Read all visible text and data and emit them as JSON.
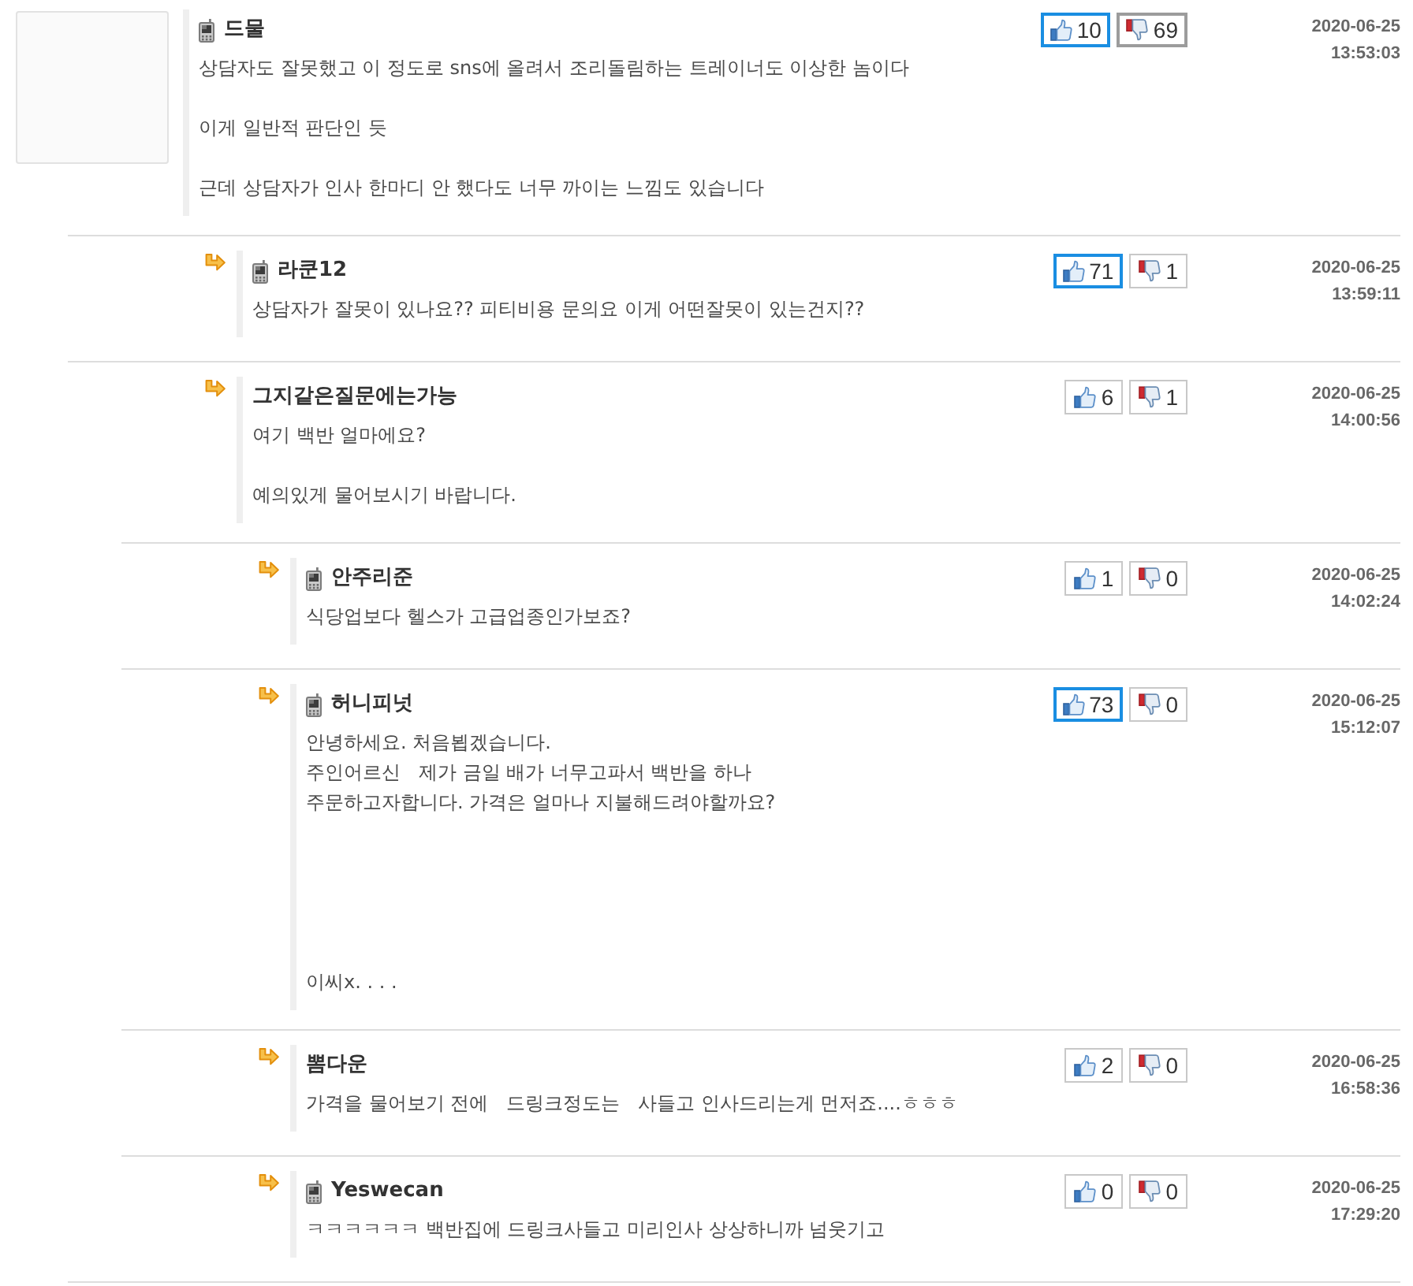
{
  "comments": [
    {
      "author": "드물",
      "mobile": true,
      "body": "상담자도 잘못했고 이 정도로 sns에 올려서 조리돌림하는 트레이너도 이상한 놈이다\n\n이게 일반적 판단인 듯\n\n근데 상담자가 인사 한마디 안 했다도 너무 까이는 느낌도 있습니다",
      "likes": {
        "count": "10",
        "emphasized": true
      },
      "dislikes": {
        "count": "69",
        "emphasized": true
      },
      "date": "2020-06-25",
      "time": "13:53:03",
      "children": [
        {
          "author": "라쿤12",
          "mobile": true,
          "body": "상담자가 잘못이 있나요?? 피티비용 문의요 이게 어떤잘못이 있는건지??",
          "likes": {
            "count": "71",
            "emphasized": true
          },
          "dislikes": {
            "count": "1",
            "emphasized": false
          },
          "date": "2020-06-25",
          "time": "13:59:11"
        },
        {
          "author": "그지같은질문에는가능",
          "mobile": false,
          "body": "여기 백반 얼마에요?\n\n예의있게 물어보시기 바랍니다.",
          "likes": {
            "count": "6",
            "emphasized": false
          },
          "dislikes": {
            "count": "1",
            "emphasized": false
          },
          "date": "2020-06-25",
          "time": "14:00:56",
          "children": [
            {
              "author": "안주리준",
              "mobile": true,
              "body": "식당업보다 헬스가 고급업종인가보죠?",
              "likes": {
                "count": "1",
                "emphasized": false
              },
              "dislikes": {
                "count": "0",
                "emphasized": false
              },
              "date": "2020-06-25",
              "time": "14:02:24"
            },
            {
              "author": "허니피넛",
              "mobile": true,
              "body": "안녕하세요. 처음뵙겠습니다.\n주인어르신   제가 금일 배가 너무고파서 백반을 하나\n주문하고자합니다. 가격은 얼마나 지불해드려야할까요?\n\n\n\n\n\n이씨x. . . .",
              "likes": {
                "count": "73",
                "emphasized": true
              },
              "dislikes": {
                "count": "0",
                "emphasized": false
              },
              "date": "2020-06-25",
              "time": "15:12:07"
            },
            {
              "author": "뽐다운",
              "mobile": false,
              "body": "가격을 물어보기 전에   드링크정도는   사들고 인사드리는게 먼저죠....ㅎㅎㅎ",
              "likes": {
                "count": "2",
                "emphasized": false
              },
              "dislikes": {
                "count": "0",
                "emphasized": false
              },
              "date": "2020-06-25",
              "time": "16:58:36"
            },
            {
              "author": "Yeswecan",
              "mobile": true,
              "body": "ㅋㅋㅋㅋㅋㅋ 백반집에 드링크사들고 미리인사 상상하니까 넘웃기고",
              "likes": {
                "count": "0",
                "emphasized": false
              },
              "dislikes": {
                "count": "0",
                "emphasized": false
              },
              "date": "2020-06-25",
              "time": "17:29:20"
            }
          ]
        }
      ]
    }
  ]
}
